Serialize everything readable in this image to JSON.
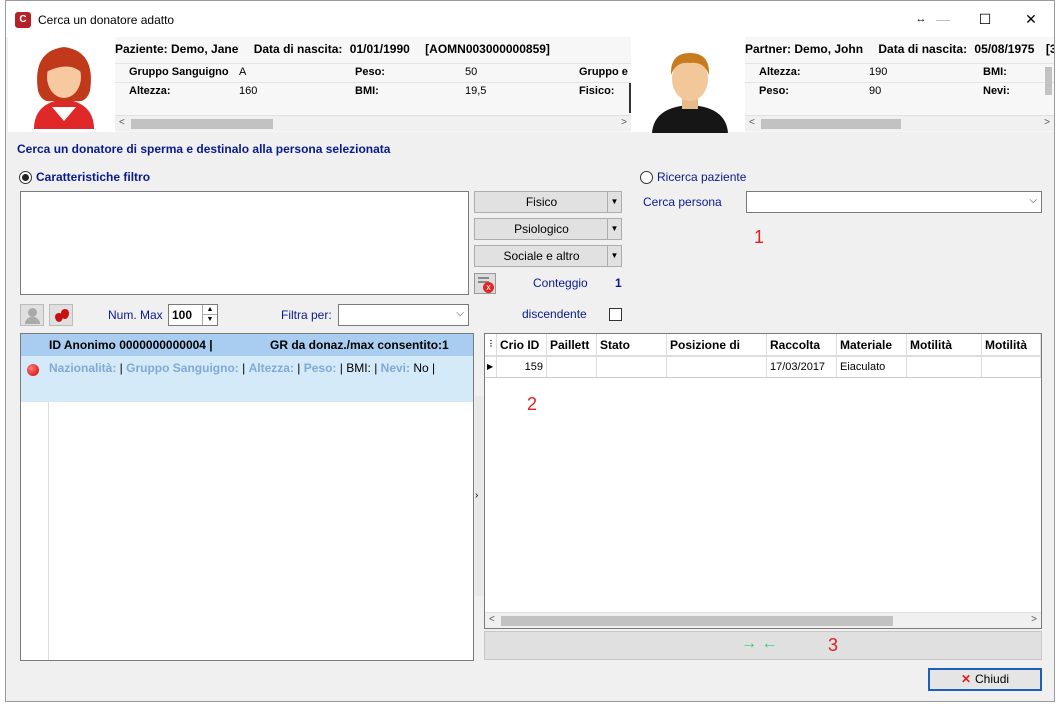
{
  "window": {
    "title": "Cerca un donatore adatto",
    "icon_letter": "C",
    "btn_restore": "↔",
    "btn_min": "—",
    "btn_max": "☐",
    "btn_close": "✕"
  },
  "patient": {
    "name_label": "Paziente: Demo, Jane",
    "dob_label": "Data di nascita:",
    "dob": "01/01/1990",
    "code": "[AOMN003000000859]",
    "rows": [
      {
        "k1": "Gruppo Sanguigno",
        "v1": "A",
        "k2": "Peso:",
        "v2": "50",
        "k3": "Gruppo e"
      },
      {
        "k1": "Altezza:",
        "v1": "160",
        "k2": "BMI:",
        "v2": "19,5",
        "k3": "Fisico:"
      }
    ]
  },
  "partner": {
    "name_label": "Partner: Demo, John",
    "dob_label": "Data di nascita:",
    "dob": "05/08/1975",
    "code": "[3",
    "rows": [
      {
        "k1": "Altezza:",
        "v1": "190",
        "k2": "BMI:"
      },
      {
        "k1": "Peso:",
        "v1": "90",
        "k2": "Nevi:"
      }
    ]
  },
  "instruction": "Cerca un donatore di sperma e destinalo alla persona selezionata",
  "filter": {
    "radio_label": "Caratteristiche filtro",
    "radio_selected": true,
    "buttons": [
      "Fisico",
      "Psiologico",
      "Sociale e altro"
    ],
    "conteggio_label": "Conteggio",
    "conteggio_value": "1",
    "num_max_label": "Num. Max",
    "num_max_value": "100",
    "filtra_label": "Filtra per:",
    "filtra_value": "",
    "discendente_label": "discendente",
    "discendente_checked": false
  },
  "search_patient": {
    "radio_label": "Ricerca paziente",
    "radio_selected": false,
    "cerca_label": "Cerca persona",
    "cerca_value": ""
  },
  "markers": {
    "m1": "1",
    "m2": "2",
    "m3": "3"
  },
  "donor_list": {
    "header_id": "ID Anonimo 0000000000004    |",
    "header_gr": "GR da donaz./max consentito:1",
    "detail": [
      {
        "k": "Nazionalità:",
        "v": " | "
      },
      {
        "k": "Gruppo Sanguigno:",
        "v": " | "
      },
      {
        "k": "Altezza:",
        "v": " | "
      },
      {
        "k": "Peso:",
        "v": " | BMI:  | "
      },
      {
        "k": "Nevi:",
        "v": " No |"
      }
    ],
    "status_color": "#e01010"
  },
  "samples": {
    "columns": [
      "Crio ID",
      "Paillett",
      "Stato",
      "Posizione di",
      "Raccolta",
      "Materiale",
      "Motilità",
      "Motilità"
    ],
    "rows": [
      [
        "159",
        "",
        "",
        "",
        "17/03/2017",
        "Eiaculato",
        "",
        ""
      ]
    ]
  },
  "transfer": {
    "label": "→ ←"
  },
  "close_button": "Chiudi",
  "colors": {
    "accent_blue": "#0a1a8c",
    "selected_row": "#a9cdf0",
    "detail_row": "#d5eaf9",
    "marker_red": "#e02020",
    "arrow_green": "#2ecc71"
  }
}
